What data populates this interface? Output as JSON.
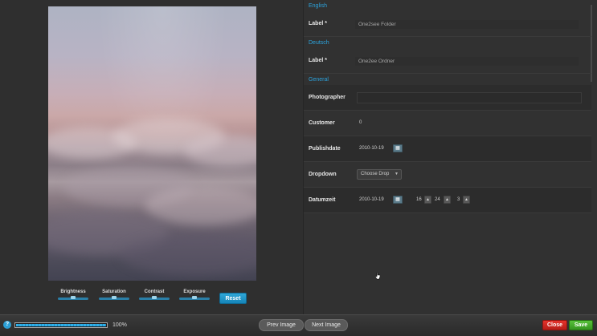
{
  "image_panel": {
    "adjustments": [
      {
        "label": "Brightness",
        "value": 0.5
      },
      {
        "label": "Saturation",
        "value": 0.5
      },
      {
        "label": "Contrast",
        "value": 0.5
      },
      {
        "label": "Exposure",
        "value": 0.5
      }
    ],
    "reset_label": "Reset"
  },
  "form": {
    "sections": {
      "english": "English",
      "deutsch": "Deutsch",
      "general": "General"
    },
    "english_label": {
      "label": "Label *",
      "value": "One2see Folder"
    },
    "deutsch_label": {
      "label": "Label *",
      "value": "One2ee Ordner"
    },
    "photographer": {
      "label": "Photographer",
      "value": ""
    },
    "customer": {
      "label": "Customer",
      "value": "0"
    },
    "publishdate": {
      "label": "Publishdate",
      "value": "2010-10-19"
    },
    "dropdown": {
      "label": "Dropdown",
      "selected": "Choose Drop"
    },
    "datumzeit": {
      "label": "Datumzeit",
      "date": "2010-10-19",
      "hour": "16",
      "minute": "24",
      "second": "3"
    }
  },
  "bottom_bar": {
    "progress_percent": 100,
    "progress_text": "100%",
    "prev_label": "Prev Image",
    "next_label": "Next Image",
    "close_label": "Close",
    "save_label": "Save"
  },
  "colors": {
    "accent": "#2ca3dd",
    "close": "#d42a24",
    "save": "#48ab2c"
  }
}
